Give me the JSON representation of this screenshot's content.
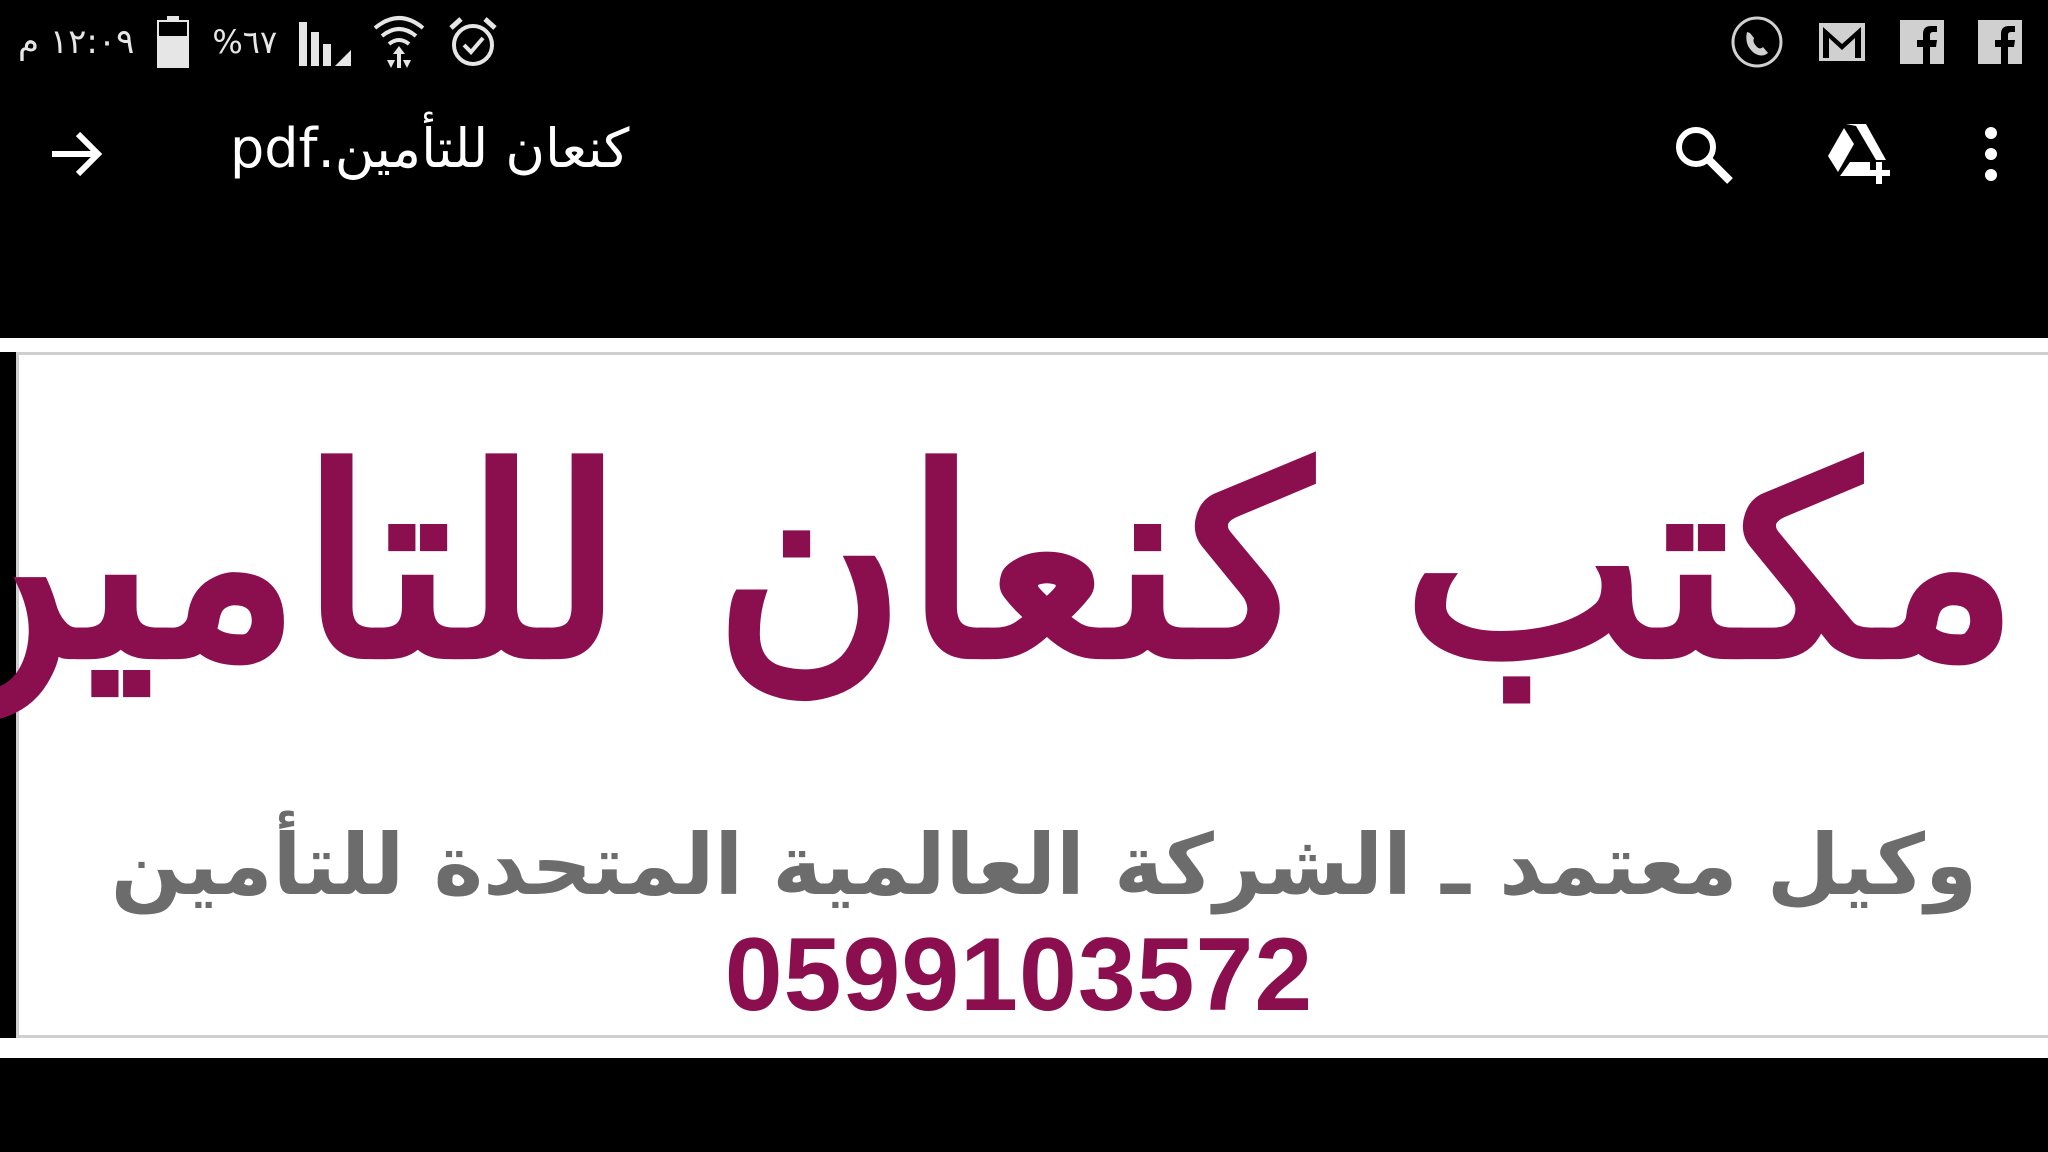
{
  "status_bar": {
    "time": "١٢:٠٩ م",
    "battery_percent": "%٦٧",
    "icons_left": [
      "battery-icon",
      "signal-icon",
      "wifi-icon",
      "alarm-icon"
    ],
    "icons_right": [
      "phone-call-icon",
      "gmail-icon",
      "facebook-icon",
      "facebook-icon"
    ]
  },
  "app_bar": {
    "title": "كنعان للتأمين.pdf",
    "back_icon": "arrow-right-icon",
    "actions": [
      "search-icon",
      "drive-add-icon",
      "more-vert-icon"
    ]
  },
  "document": {
    "headline": "مكتب كنعان للتامين",
    "subline": "وكيل معتمد ـ الشركة العالمية المتحدة للتأمين",
    "phone": "0599103572"
  },
  "colors": {
    "accent": "#8b0f4f",
    "subline_gray": "#6c6c6c",
    "background": "#000000"
  }
}
